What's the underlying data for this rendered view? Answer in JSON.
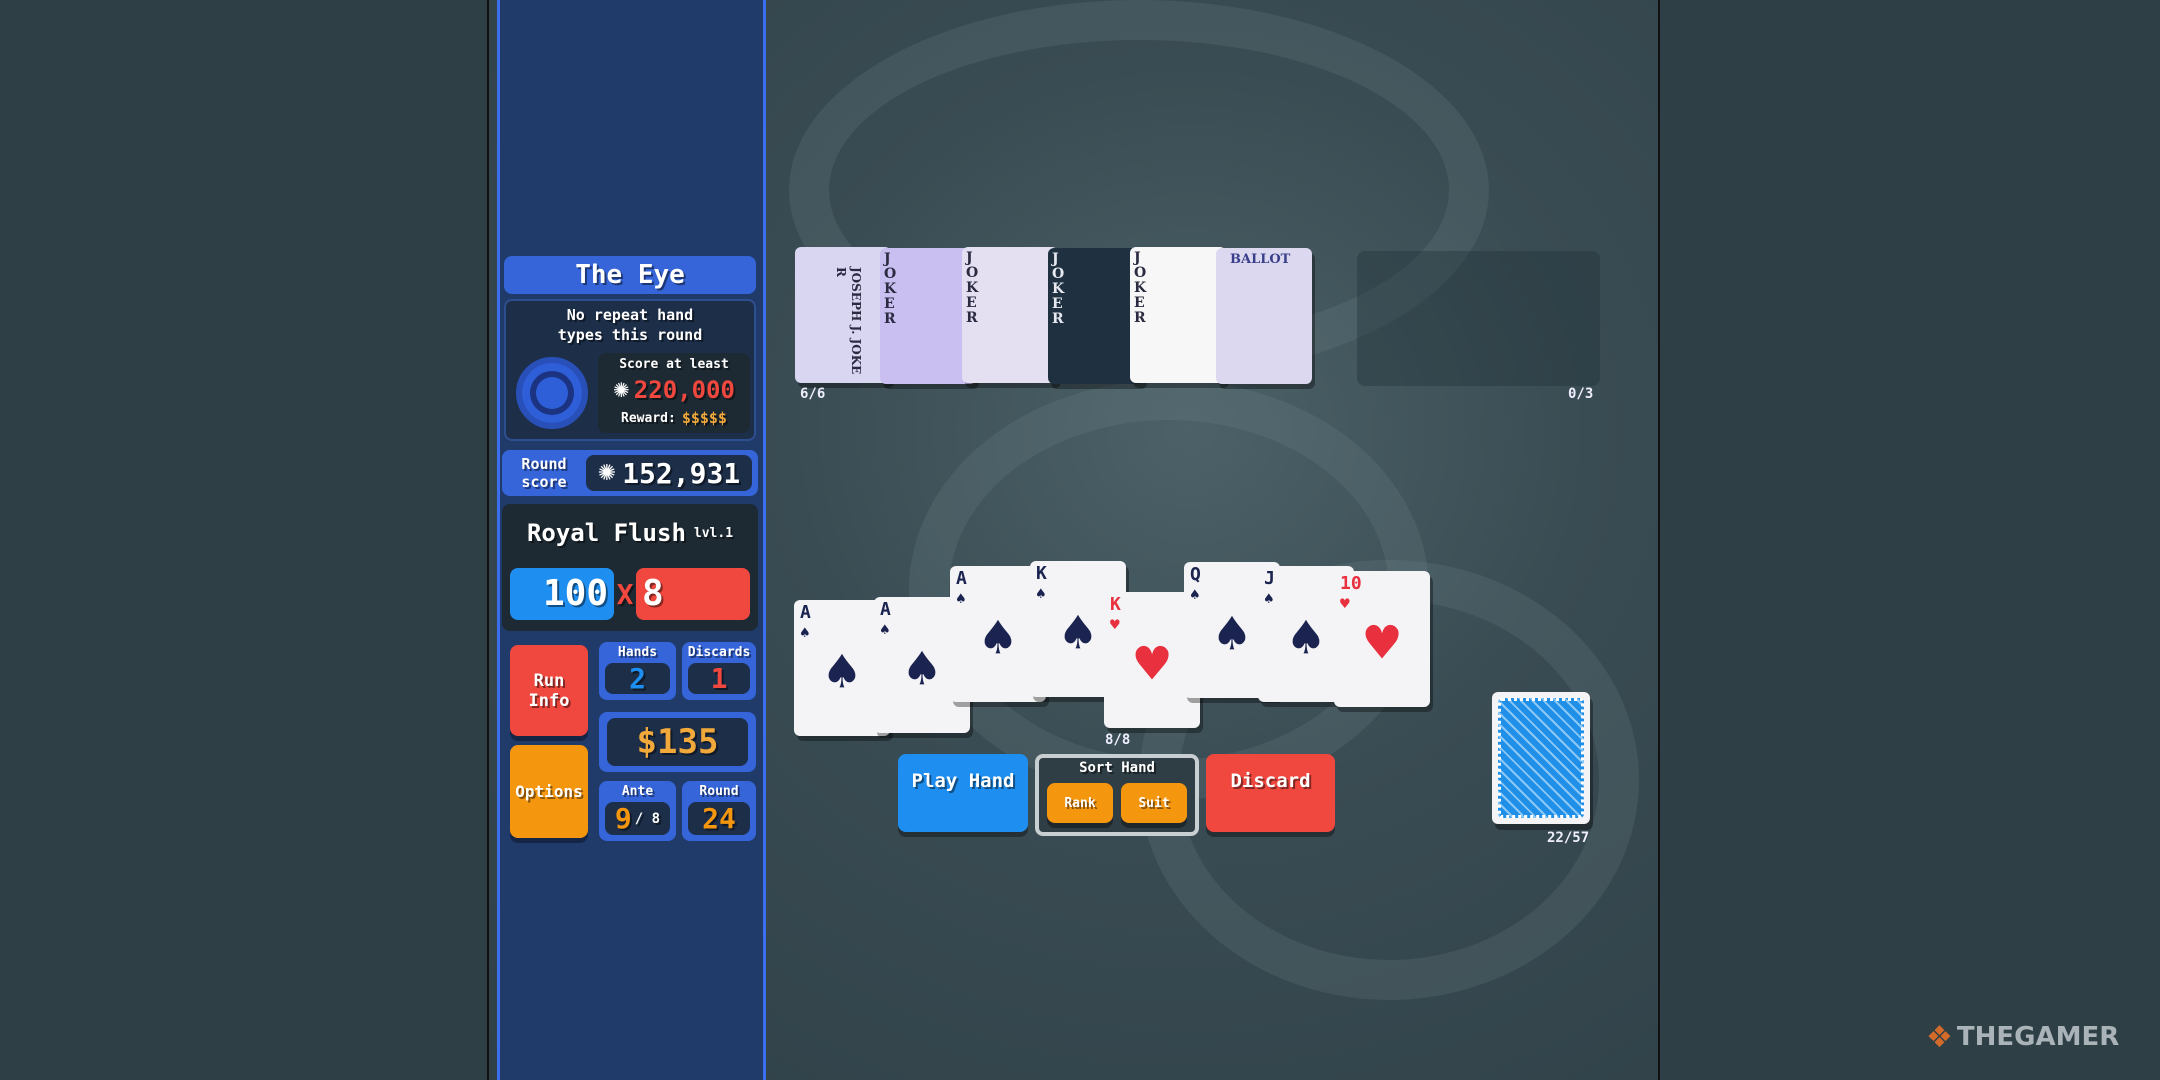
{
  "blind": {
    "name": "The Eye",
    "description_line1": "No repeat hand",
    "description_line2": "types this round",
    "score_label": "Score at least",
    "score_target": "220,000",
    "reward_label": "Reward:",
    "reward_value": "$$$$$"
  },
  "round_score": {
    "label_line1": "Round",
    "label_line2": "score",
    "value": "152,931"
  },
  "hand_type": {
    "name": "Royal Flush",
    "level": "lvl.1",
    "chips": "100",
    "times": "X",
    "mult": "8"
  },
  "buttons": {
    "run_info_1": "Run",
    "run_info_2": "Info",
    "options": "Options",
    "play_hand": "Play Hand",
    "sort_hand": "Sort Hand",
    "rank": "Rank",
    "suit": "Suit",
    "discard": "Discard"
  },
  "stats": {
    "hands_label": "Hands",
    "hands": "2",
    "discards_label": "Discards",
    "discards": "1",
    "money": "$135",
    "ante_label": "Ante",
    "ante": "9",
    "ante_max": "/ 8",
    "round_label": "Round",
    "round": "24"
  },
  "jokers": {
    "count": "6/6",
    "items": [
      {
        "label": "JOSEPH J. JOKER",
        "bg": "#d9d6f2"
      },
      {
        "label": "JOKER",
        "bg": "#c9bff0"
      },
      {
        "label": "JOKER",
        "bg": "#e4e0f2"
      },
      {
        "label": "JOKER",
        "bg": "#1f3140"
      },
      {
        "label": "JOKER",
        "bg": "#f7f7f7"
      },
      {
        "label": "BALLOT",
        "bg": "#dcd8f0"
      }
    ]
  },
  "consumables": {
    "count": "0/3"
  },
  "hand": {
    "count": "8/8",
    "cards": [
      {
        "rank": "A",
        "suit": "♠"
      },
      {
        "rank": "A",
        "suit": "♠"
      },
      {
        "rank": "A",
        "suit": "♠"
      },
      {
        "rank": "K",
        "suit": "♠"
      },
      {
        "rank": "K",
        "suit": "♥"
      },
      {
        "rank": "Q",
        "suit": "♠"
      },
      {
        "rank": "J",
        "suit": "♠"
      },
      {
        "rank": "10",
        "suit": "♥"
      }
    ]
  },
  "deck": {
    "count": "22/57",
    "color": "#1f8fe8"
  },
  "watermark": "THEGAMER",
  "colors": {
    "chips": "#1e8ff0",
    "mult": "#f0473e",
    "money": "#f2a93b",
    "options": "#f5960f"
  }
}
